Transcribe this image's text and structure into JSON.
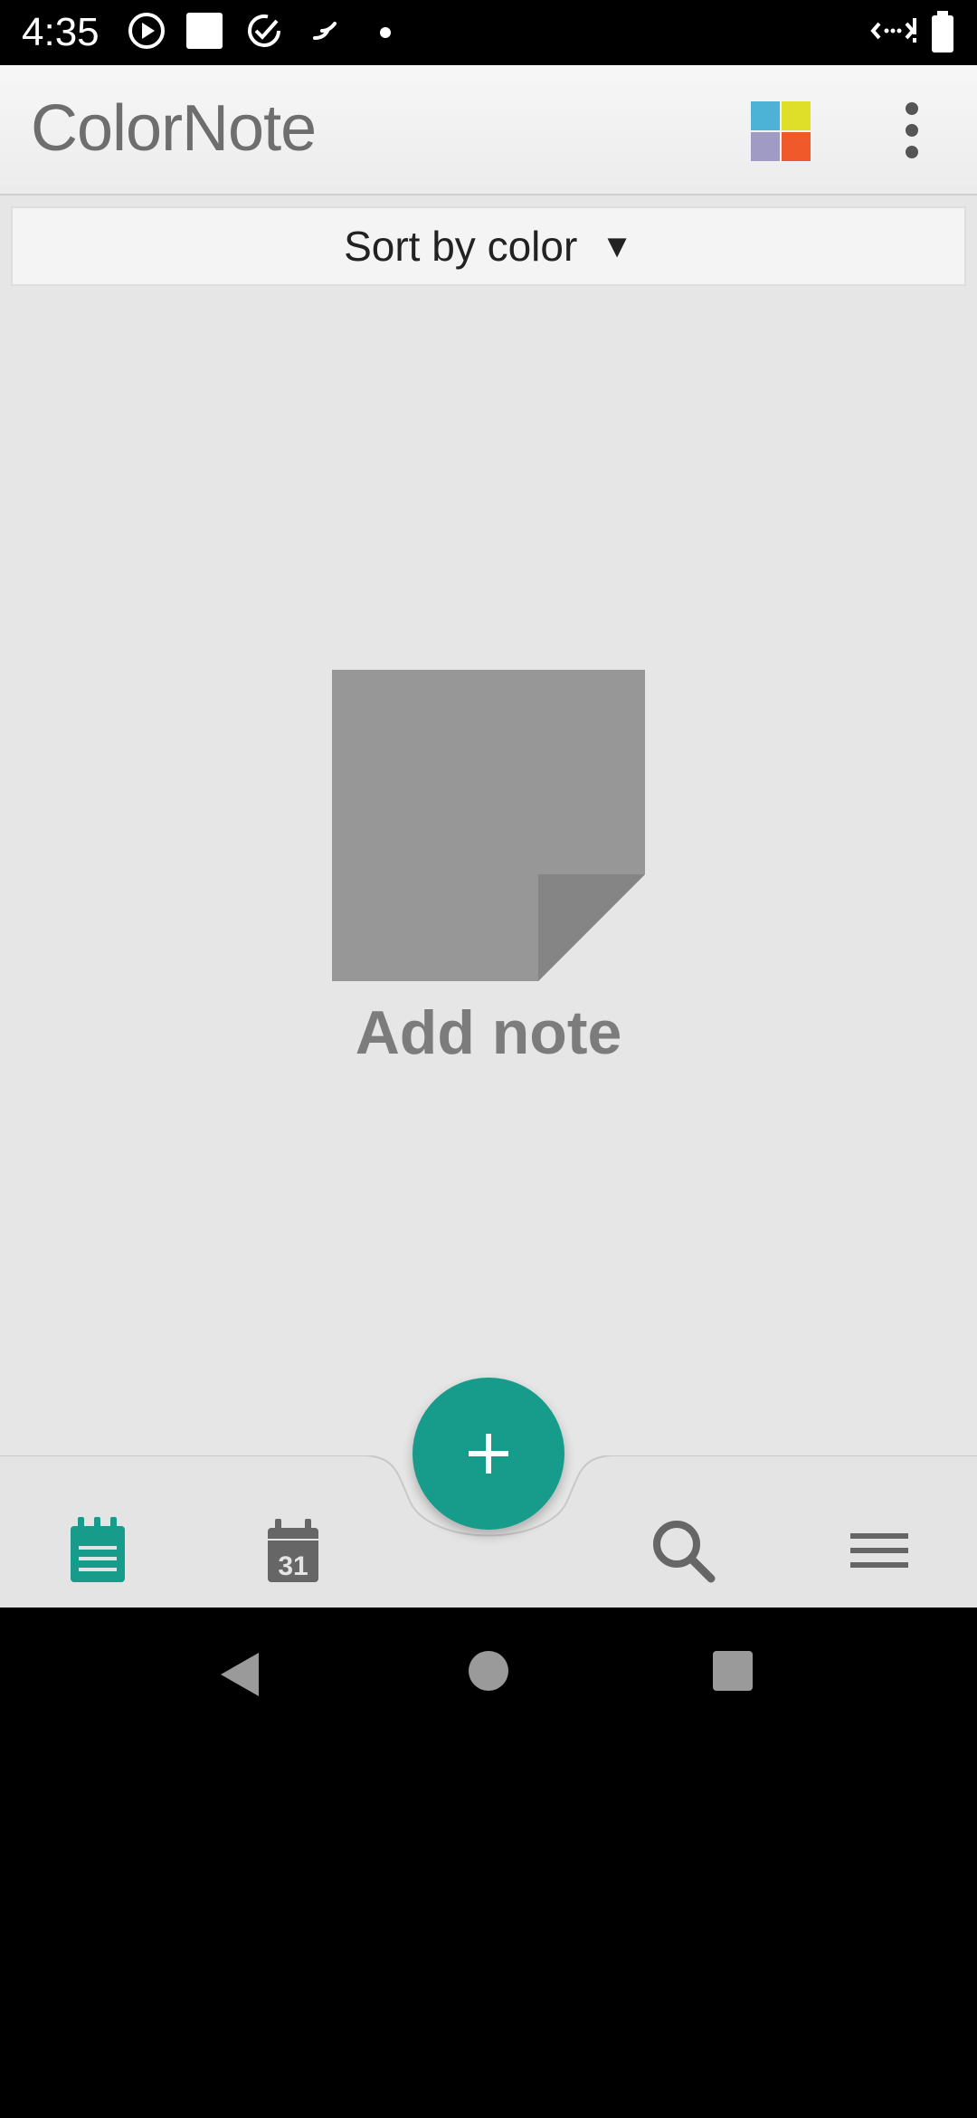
{
  "status_bar": {
    "time": "4:35",
    "icons": [
      "play-circle-icon",
      "white-square-icon",
      "check-circle-icon",
      "wind-icon",
      "dot-icon",
      "data-saver-icon",
      "battery-icon"
    ]
  },
  "toolbar": {
    "app_name": "ColorNote",
    "icons": [
      "color-grid-icon",
      "more-vert-icon"
    ],
    "colors": {
      "blue": "#4db3d6",
      "yellow": "#dfdf2a",
      "purple": "#9f9bc4",
      "orange": "#f05a2a"
    }
  },
  "sort": {
    "label": "Sort by color",
    "arrow": "▼"
  },
  "empty_state": {
    "label": "Add note",
    "icon": "blank-note-icon"
  },
  "bottom_nav": {
    "items": [
      "notes-icon",
      "calendar-icon",
      "search-icon",
      "menu-icon"
    ],
    "calendar_day": "31",
    "active_color": "#179b8b",
    "fab_icon": "plus-icon"
  },
  "system_nav": {
    "items": [
      "back-icon",
      "home-icon",
      "recents-icon"
    ]
  }
}
